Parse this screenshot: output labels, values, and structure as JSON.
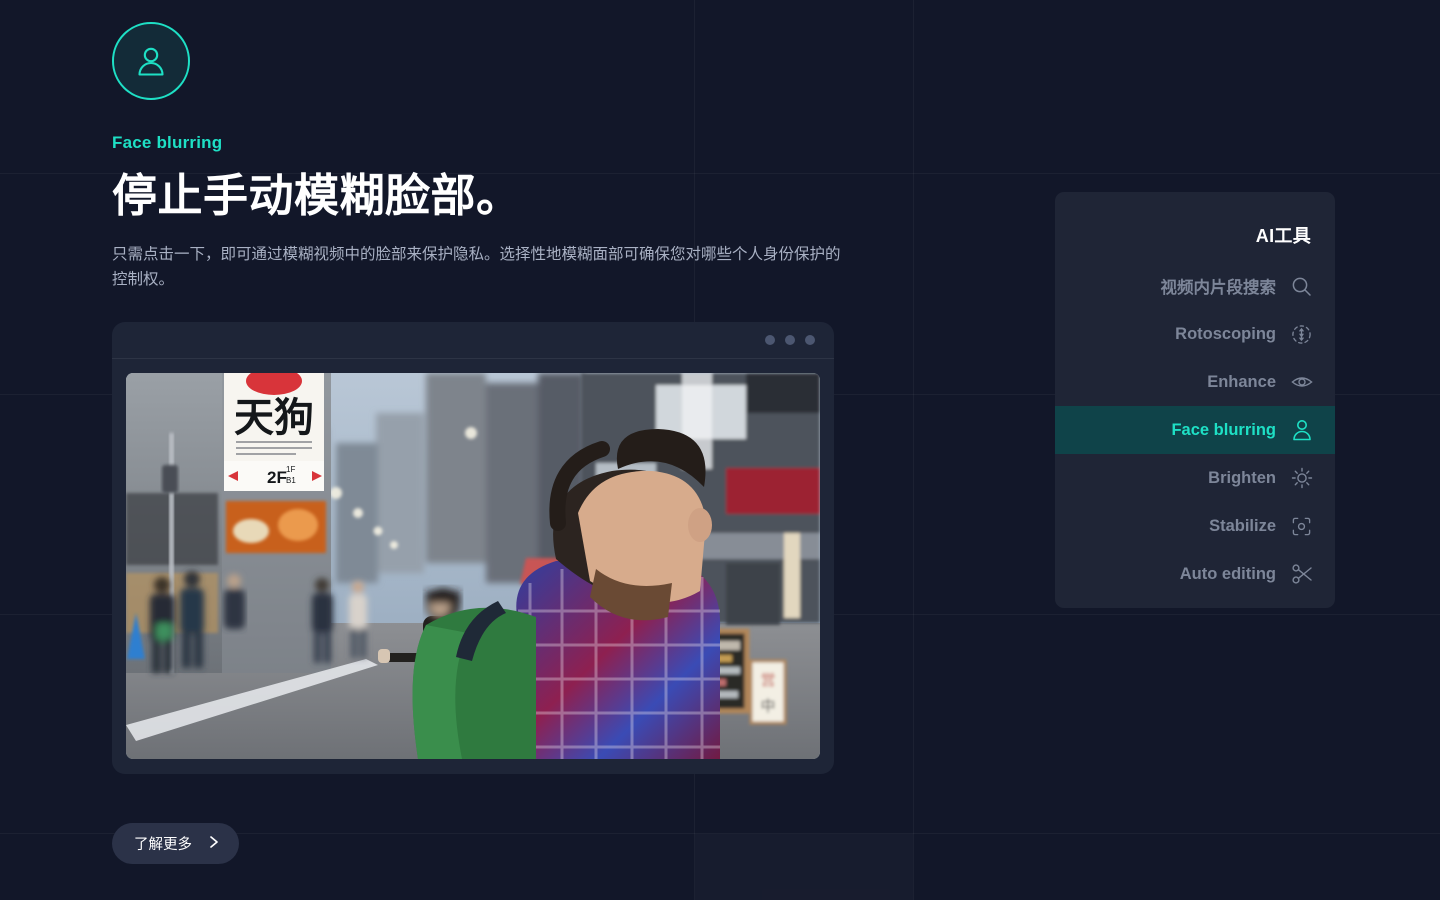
{
  "theme": {
    "page_bg": "#121729",
    "accent": "#1ee0c5",
    "panel_bg": "#1f2536",
    "active_row_bg": "#0f4349",
    "muted_text": "#7d8699",
    "body_text": "#a9b1c4"
  },
  "hero": {
    "badge_icon": "person-icon",
    "eyebrow": "Face blurring",
    "headline": "停止手动模糊脸部。",
    "description": "只需点击一下，即可通过模糊视频中的脸部来保护隐私。选择性地模糊面部可确保您对哪些个人身份保护的控制权。",
    "cta_label": "了解更多",
    "cta_icon": "chevron-right-icon"
  },
  "player": {
    "window_dots": 3,
    "scene_description": "东京街景视频，行人脸部已模糊处理",
    "signs": {
      "main_sign": "天狗",
      "floor_label": "2F",
      "floor_sub_1": "1F",
      "floor_sub_2": "B1",
      "sandwich_board": "営業中"
    }
  },
  "tools_panel": {
    "title": "AI工具",
    "items": [
      {
        "label": "视频内片段搜索",
        "icon": "search-icon",
        "active": false
      },
      {
        "label": "Rotoscoping",
        "icon": "rotoscope-icon",
        "active": false
      },
      {
        "label": "Enhance",
        "icon": "eye-icon",
        "active": false
      },
      {
        "label": "Face blurring",
        "icon": "person-icon",
        "active": true
      },
      {
        "label": "Brighten",
        "icon": "sun-icon",
        "active": false
      },
      {
        "label": "Stabilize",
        "icon": "stabilize-icon",
        "active": false
      },
      {
        "label": "Auto editing",
        "icon": "scissors-icon",
        "active": false
      }
    ]
  }
}
